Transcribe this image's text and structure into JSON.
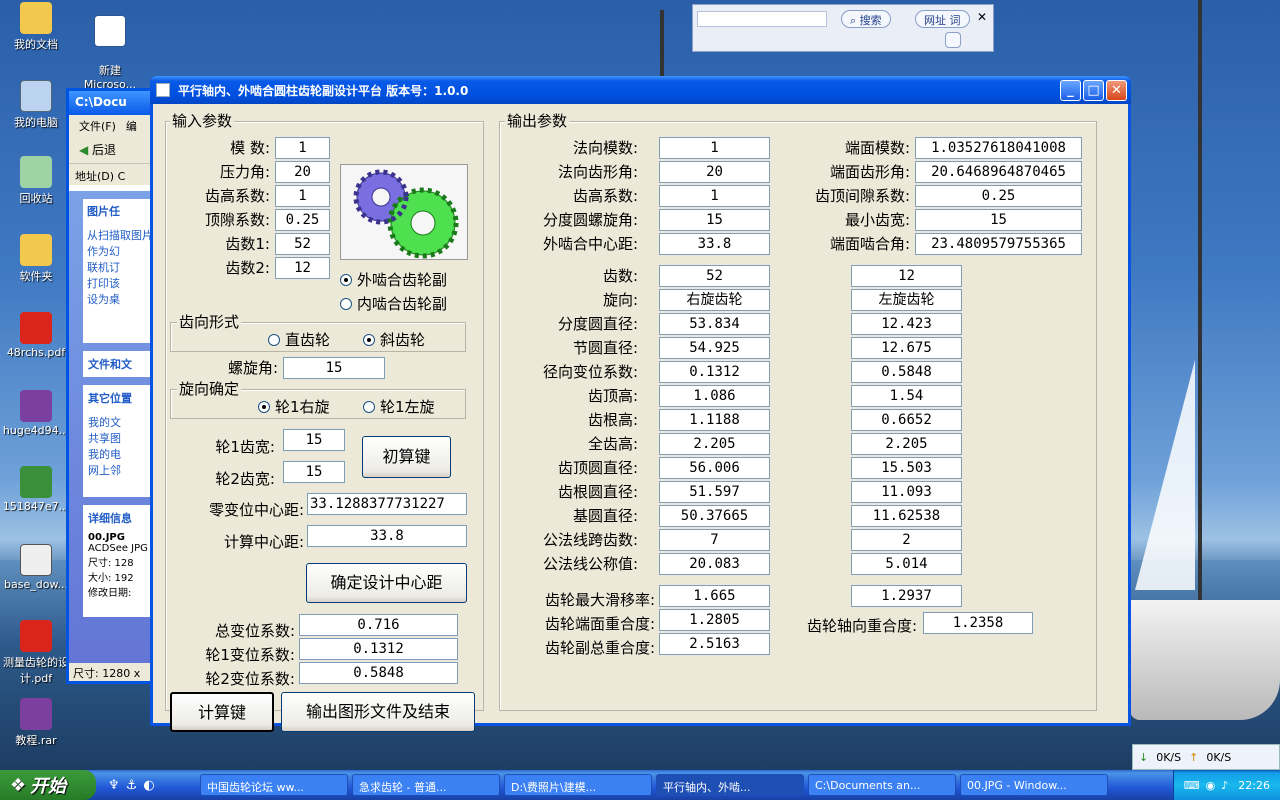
{
  "desktop": {
    "icons": [
      {
        "label": "我的文档"
      },
      {
        "label": "新建\nMicroso..."
      },
      {
        "label": "我的电脑"
      },
      {
        "label": "回收站"
      },
      {
        "label": "软件夹"
      },
      {
        "label": "48rchs.pdf"
      },
      {
        "label": "huge4d94..."
      },
      {
        "label": "151847e7..."
      },
      {
        "label": "base_dow..."
      },
      {
        "label": "测量齿轮的设计.pdf"
      },
      {
        "label": "教程.rar"
      }
    ]
  },
  "searchbar": {
    "search_label": "搜索",
    "url_label": "网址 词"
  },
  "explorer": {
    "title": "C:\\Docu",
    "menu_file": "文件(F)",
    "menu_edit": "编",
    "back": "后退",
    "address": "地址(D)",
    "addr_value": "C",
    "panel_pictures": "图片任",
    "pic_items": [
      "从扫描取图片",
      "作为幻",
      "联机订",
      "打印该",
      "设为桌"
    ],
    "panel_files": "文件和文",
    "panel_other": "其它位置",
    "other_items": [
      "我的文",
      "共享图",
      "我的电",
      "网上邻"
    ],
    "panel_detail": "详细信息",
    "detail_name": "00.JPG",
    "detail_app": "ACDSee JPG",
    "detail_size": "尺寸: 128",
    "detail_bytes": "大小: 192",
    "detail_mod": "修改日期:",
    "status_size": "尺寸: 1280 x"
  },
  "window": {
    "title": "平行轴内、外啮合圆柱齿轮副设计平台 版本号：1.0.0"
  },
  "input": {
    "legend": "输入参数",
    "module_label": "模    数:",
    "module": "1",
    "pressure_label": "压力角:",
    "pressure": "20",
    "addendum_label": "齿高系数:",
    "addendum": "1",
    "clearance_label": "顶隙系数:",
    "clearance": "0.25",
    "z1_label": "齿数1:",
    "z1": "52",
    "z2_label": "齿数2:",
    "z2": "12",
    "external_label": "外啮合齿轮副",
    "internal_label": "内啮合齿轮副",
    "tooth_form_legend": "齿向形式",
    "spur_label": "直齿轮",
    "helical_label": "斜齿轮",
    "helix_label": "螺旋角:",
    "helix": "15",
    "hand_legend": "旋向确定",
    "hand1_label": "轮1右旋",
    "hand2_label": "轮1左旋",
    "b1_label": "轮1齿宽:",
    "b1": "15",
    "b2_label": "轮2齿宽:",
    "b2": "15",
    "init_btn": "初算键",
    "zero_center_label": "零变位中心距:",
    "zero_center": "33.1288377731227",
    "calc_center_label": "计算中心距:",
    "calc_center": "33.8",
    "confirm_btn": "确定设计中心距",
    "total_shift_label": "总变位系数:",
    "total_shift": "0.716",
    "shift1_label": "轮1变位系数:",
    "shift1": "0.1312",
    "shift2_label": "轮2变位系数:",
    "shift2": "0.5848",
    "calc_btn": "计算键",
    "export_btn": "输出图形文件及结束"
  },
  "output": {
    "legend": "输出参数",
    "normal_module_label": "法向模数:",
    "normal_module": "1",
    "normal_pressure_label": "法向齿形角:",
    "normal_pressure": "20",
    "addendum_label": "齿高系数:",
    "addendum": "1",
    "ref_helix_label": "分度圆螺旋角:",
    "ref_helix": "15",
    "center_label": "外啮合中心距:",
    "center": "33.8",
    "transverse_module_label": "端面模数:",
    "transverse_module": "1.03527618041008",
    "transverse_pressure_label": "端面齿形角:",
    "transverse_pressure": "20.6468964870465",
    "tip_clearance_label": "齿顶间隙系数:",
    "tip_clearance": "0.25",
    "min_width_label": "最小齿宽:",
    "min_width": "15",
    "transverse_mesh_label": "端面啮合角:",
    "transverse_mesh": "23.4809579755365",
    "rows": [
      {
        "label": "齿数:",
        "g1": "52",
        "g2": "12"
      },
      {
        "label": "旋向:",
        "g1": "右旋齿轮",
        "g2": "左旋齿轮"
      },
      {
        "label": "分度圆直径:",
        "g1": "53.834",
        "g2": "12.423"
      },
      {
        "label": "节圆直径:",
        "g1": "54.925",
        "g2": "12.675"
      },
      {
        "label": "径向变位系数:",
        "g1": "0.1312",
        "g2": "0.5848"
      },
      {
        "label": "齿顶高:",
        "g1": "1.086",
        "g2": "1.54"
      },
      {
        "label": "齿根高:",
        "g1": "1.1188",
        "g2": "0.6652"
      },
      {
        "label": "全齿高:",
        "g1": "2.205",
        "g2": "2.205"
      },
      {
        "label": "齿顶圆直径:",
        "g1": "56.006",
        "g2": "15.503"
      },
      {
        "label": "齿根圆直径:",
        "g1": "51.597",
        "g2": "11.093"
      },
      {
        "label": "基圆直径:",
        "g1": "50.37665",
        "g2": "11.62538"
      },
      {
        "label": "公法线跨齿数:",
        "g1": "7",
        "g2": "2"
      },
      {
        "label": "公法线公称值:",
        "g1": "20.083",
        "g2": "5.014"
      }
    ],
    "slide_label": "齿轮最大滑移率:",
    "slide1": "1.665",
    "slide2": "1.2937",
    "transverse_contact_label": "齿轮端面重合度:",
    "transverse_contact": "1.2805",
    "axial_contact_label": "齿轮轴向重合度:",
    "axial_contact": "1.2358",
    "total_contact_label": "齿轮副总重合度:",
    "total_contact": "2.5163"
  },
  "taskbar": {
    "start": "开始",
    "tasks": [
      "中国齿轮论坛 ww...",
      "急求齿轮 - 普通...",
      "D:\\费照片\\建模...",
      "平行轴内、外啮...",
      "C:\\Documents an...",
      "00.JPG - Window..."
    ],
    "clock": "22:26",
    "down_speed": "0K/S",
    "up_speed": "0K/S"
  }
}
